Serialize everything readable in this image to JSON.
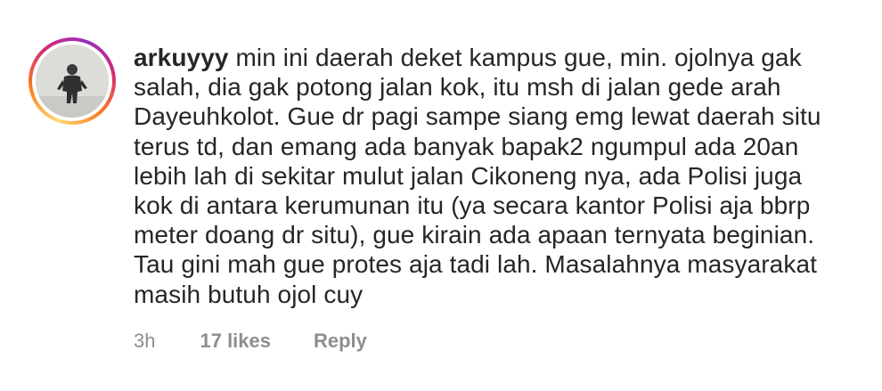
{
  "comment": {
    "username": "arkuyyy",
    "text_lines": [
      "min ini daerah deket kampus gue, min. ojolnya gak",
      "salah, dia gak potong jalan kok, itu msh di jalan gede arah",
      "Dayeuhkolot. Gue dr pagi sampe siang emg lewat daerah situ",
      "terus td, dan emang ada banyak bapak2 ngumpul ada 20an",
      "lebih lah di sekitar mulut jalan Cikoneng nya, ada Polisi juga",
      "kok di antara kerumunan itu (ya secara kantor Polisi aja bbrp",
      "meter doang dr situ), gue kirain ada apaan ternyata beginian.",
      "Tau gini mah gue protes aja tadi lah. Masalahnya masyarakat",
      "masih butuh ojol cuy"
    ],
    "time": "3h",
    "likes": "17 likes",
    "reply_label": "Reply"
  },
  "avatar": {
    "icon": "profile-photo",
    "story_ring_colors": [
      "#feda75",
      "#fa7e1e",
      "#d62976",
      "#962fbf"
    ]
  },
  "colors": {
    "text": "#262626",
    "meta": "#8e8e8e",
    "background": "#ffffff"
  }
}
